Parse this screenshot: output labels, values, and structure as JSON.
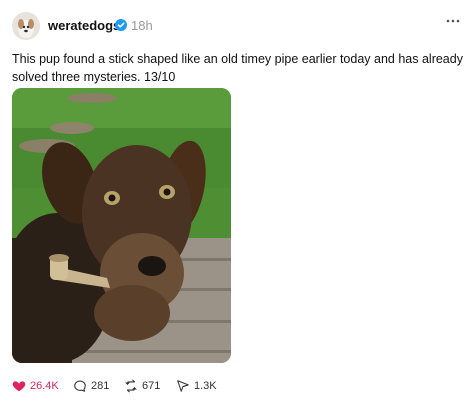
{
  "post": {
    "username": "weratedogs",
    "timestamp": "18h",
    "caption": "This pup found a stick shaped like an old timey pipe earlier today and has already solved three mysteries. 13/10",
    "image_alt_icon": "dog-photo",
    "verified": true
  },
  "actions": {
    "likes": "26.4K",
    "replies": "281",
    "reposts": "671",
    "shares": "1.3K",
    "liked": true
  },
  "colors": {
    "like_accent": "#e0245e",
    "verified_blue": "#1d9bf0",
    "muted_text": "#9a9a9a"
  }
}
